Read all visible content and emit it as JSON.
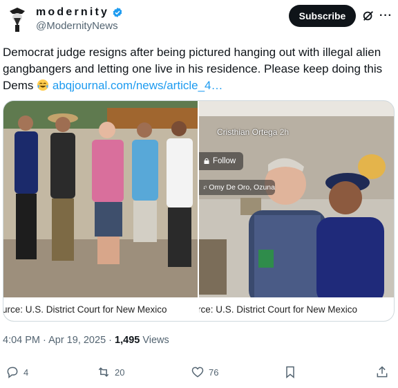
{
  "header": {
    "display_name": "modernity",
    "handle": "@ModernityNews",
    "subscribe_label": "Subscribe",
    "more_label": "···"
  },
  "tweet": {
    "text": "Democrat judge resigns after being pictured hanging out with illegal alien gangbangers and letting one live in his residence. Please keep doing this Dems ",
    "link": "abqjournal.com/news/article_4…"
  },
  "media": {
    "left_caption": "urce: U.S. District Court for New Mexico",
    "right_caption": "rce: U.S. District Court for New Mexico",
    "ig_name": "Cristhian Ortega",
    "ig_follow": "Follow",
    "ig_song": "Omy De Oro, Ozuna"
  },
  "meta": {
    "time": "4:04 PM",
    "date": "Apr 19, 2025",
    "views_count": "1,495",
    "views_label": "Views"
  },
  "actions": {
    "replies": "4",
    "reposts": "20",
    "likes": "76"
  },
  "colors": {
    "link": "#1d9bf0",
    "verified": "#1d9bf0",
    "subscribe_bg": "#0f1419",
    "muted": "#536471"
  }
}
